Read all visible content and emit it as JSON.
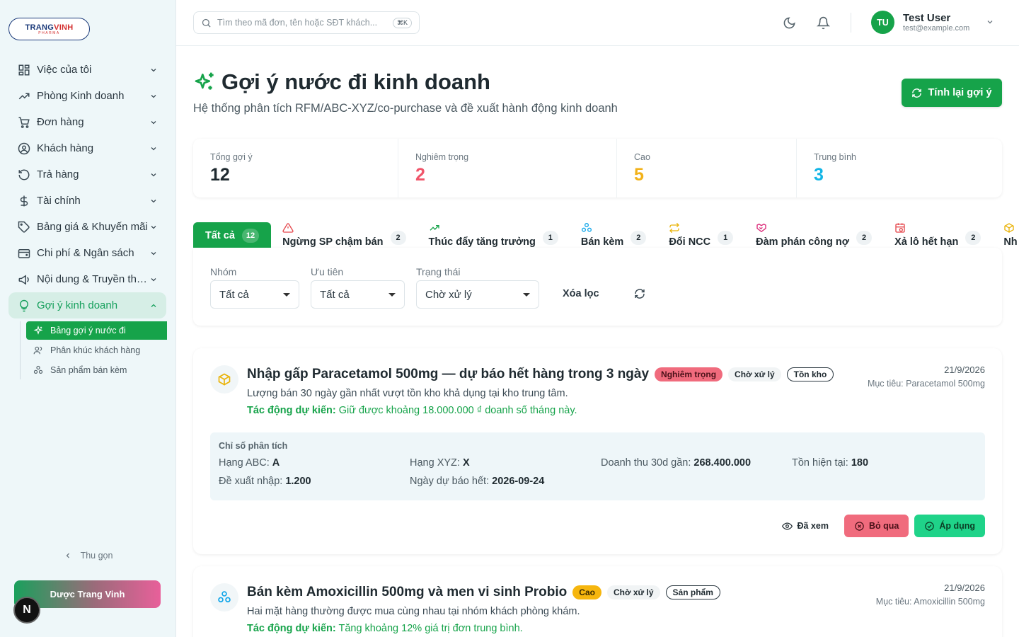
{
  "brand": {
    "logo_text_a": "TRANG",
    "logo_text_b": "VINH",
    "logo_sub": "PHARMA"
  },
  "sidebar": {
    "items": [
      {
        "label": "Việc của tôi",
        "icon": "grid-icon"
      },
      {
        "label": "Phòng Kinh doanh",
        "icon": "trending-up-icon"
      },
      {
        "label": "Đơn hàng",
        "icon": "cart-icon"
      },
      {
        "label": "Khách hàng",
        "icon": "user-circle-icon"
      },
      {
        "label": "Trả hàng",
        "icon": "undo-icon"
      },
      {
        "label": "Tài chính",
        "icon": "dollar-icon"
      },
      {
        "label": "Bảng giá & Khuyến mãi",
        "icon": "tag-icon"
      },
      {
        "label": "Chi phí & Ngân sách",
        "icon": "wallet-icon"
      },
      {
        "label": "Nội dung & Truyền thông",
        "icon": "megaphone-icon"
      },
      {
        "label": "Gợi ý kinh doanh",
        "icon": "lightbulb-icon",
        "active": true
      }
    ],
    "sub_items": [
      {
        "label": "Bảng gợi ý nước đi",
        "active": true
      },
      {
        "label": "Phân khúc khách hàng"
      },
      {
        "label": "Sản phẩm bán kèm"
      }
    ],
    "collapse_label": "Thu gọn",
    "promo_label": "Dược Trang Vinh",
    "badge_letter": "N"
  },
  "header": {
    "search_placeholder": "Tìm theo mã đơn, tên hoặc SĐT khách...",
    "search_shortcut": "⌘K",
    "avatar_initials": "TU",
    "user_name": "Test User",
    "user_email": "test@example.com"
  },
  "page": {
    "title": "Gợi ý nước đi kinh doanh",
    "subtitle": "Hệ thống phân tích RFM/ABC-XYZ/co-purchase và đề xuất hành động kinh doanh",
    "recalc_label": "Tính lại gợi ý"
  },
  "stats": [
    {
      "label": "Tổng gợi ý",
      "value": "12",
      "color": "#1f2a30"
    },
    {
      "label": "Nghiêm trọng",
      "value": "2",
      "color": "#f0556a"
    },
    {
      "label": "Cao",
      "value": "5",
      "color": "#f2b21a"
    },
    {
      "label": "Trung bình",
      "value": "3",
      "color": "#12b5e6"
    }
  ],
  "tabs": [
    {
      "label": "Tất cả",
      "count": "12",
      "active": true
    },
    {
      "label": "Ngừng SP chậm bán",
      "count": "2",
      "icon": "alert-triangle-icon",
      "color": "#e5484d"
    },
    {
      "label": "Thúc đẩy tăng trưởng",
      "count": "1",
      "icon": "trending-up-icon",
      "color": "#16a34a"
    },
    {
      "label": "Bán kèm",
      "count": "2",
      "icon": "boxes-icon",
      "color": "#0ea5e9"
    },
    {
      "label": "Đổi NCC",
      "count": "1",
      "icon": "swap-icon",
      "color": "#eab308"
    },
    {
      "label": "Đàm phán công nợ",
      "count": "2",
      "icon": "handshake-icon",
      "color": "#db2777"
    },
    {
      "label": "Xả lô hết hạn",
      "count": "2",
      "icon": "calendar-x-icon",
      "color": "#e5484d"
    },
    {
      "label": "Nh",
      "count": "",
      "icon": "package-icon",
      "color": "#eab308"
    }
  ],
  "filters": {
    "group_label": "Nhóm",
    "group_value": "Tất cả",
    "priority_label": "Ưu tiên",
    "priority_value": "Tất cả",
    "status_label": "Trạng thái",
    "status_value": "Chờ xử lý",
    "clear_label": "Xóa lọc"
  },
  "cards": [
    {
      "icon": "package-icon",
      "title": "Nhập gấp Paracetamol 500mg — dự báo hết hàng trong 3 ngày",
      "severity": "Nghiêm trọng",
      "status": "Chờ xử lý",
      "category": "Tồn kho",
      "description": "Lượng bán 30 ngày gần nhất vượt tồn kho khả dụng tại kho trung tâm.",
      "impact_label": "Tác động dự kiến:",
      "impact_text": " Giữ được khoảng 18.000.000 ₫ doanh số tháng này.",
      "date": "21/9/2026",
      "target": "Mục tiêu: Paracetamol 500mg",
      "metrics_title": "Chỉ số phân tích",
      "metrics": [
        {
          "label": "Hạng ABC:",
          "value": "A"
        },
        {
          "label": "Hạng XYZ:",
          "value": "X"
        },
        {
          "label": "Doanh thu 30d gần:",
          "value": "268.400.000"
        },
        {
          "label": "Tồn hiện tại:",
          "value": "180"
        },
        {
          "label": "Đề xuất nhập:",
          "value": "1.200"
        },
        {
          "label": "Ngày dự báo hết:",
          "value": "2026-09-24"
        }
      ],
      "actions": {
        "seen": "Đã xem",
        "skip": "Bỏ qua",
        "apply": "Áp dụng"
      }
    },
    {
      "icon": "boxes-icon",
      "title": "Bán kèm Amoxicillin 500mg và men vi sinh Probio",
      "severity": "Cao",
      "status": "Chờ xử lý",
      "category": "Sản phẩm",
      "description": "Hai mặt hàng thường được mua cùng nhau tại nhóm khách phòng khám.",
      "impact_label": "Tác động dự kiến:",
      "impact_text": " Tăng khoảng 12% giá trị đơn trung bình.",
      "date": "21/9/2026",
      "target": "Mục tiêu: Amoxicillin 500mg"
    }
  ]
}
